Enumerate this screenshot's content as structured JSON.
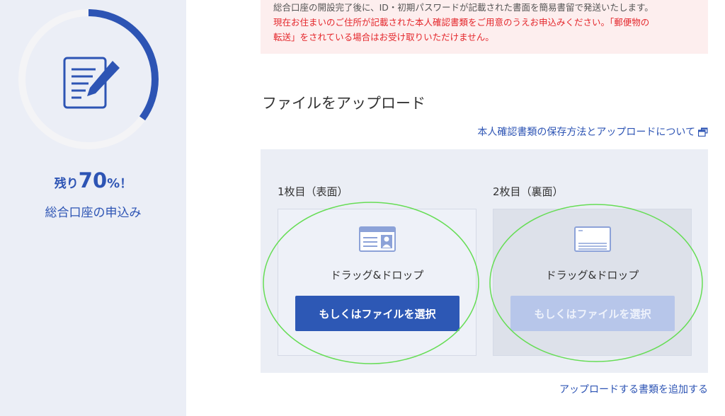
{
  "progress": {
    "percent": 70,
    "prefix": "残り",
    "number": "70",
    "unit": "%",
    "suffix": "！",
    "application_name": "総合口座の申込み"
  },
  "notice": {
    "line0": "総合口座の開設完了後に、ID・初期パスワードが記載された書面を簡易書留で発送いたします。",
    "line1": "現在お住まいのご住所が記載された本人確認書類をご用意のうえお申込みください。「郵便物の",
    "line2": "転送」をされている場合はお受け取りいただけません。"
  },
  "upload": {
    "title": "ファイルをアップロード",
    "help_link": "本人確認書類の保存方法とアップロードについて",
    "front": {
      "label": "1枚目（表面）",
      "drag_text": "ドラッグ&ドロップ",
      "button": "もしくはファイルを選択"
    },
    "back": {
      "label": "2枚目（裏面）",
      "drag_text": "ドラッグ&ドロップ",
      "button": "もしくはファイルを選択"
    },
    "add_link": "アップロードする書類を追加する"
  },
  "colors": {
    "accent": "#2d58b5",
    "sidebar_bg": "#ebeef6",
    "notice_text": "#e4262b",
    "annotation": "#66dd55"
  }
}
